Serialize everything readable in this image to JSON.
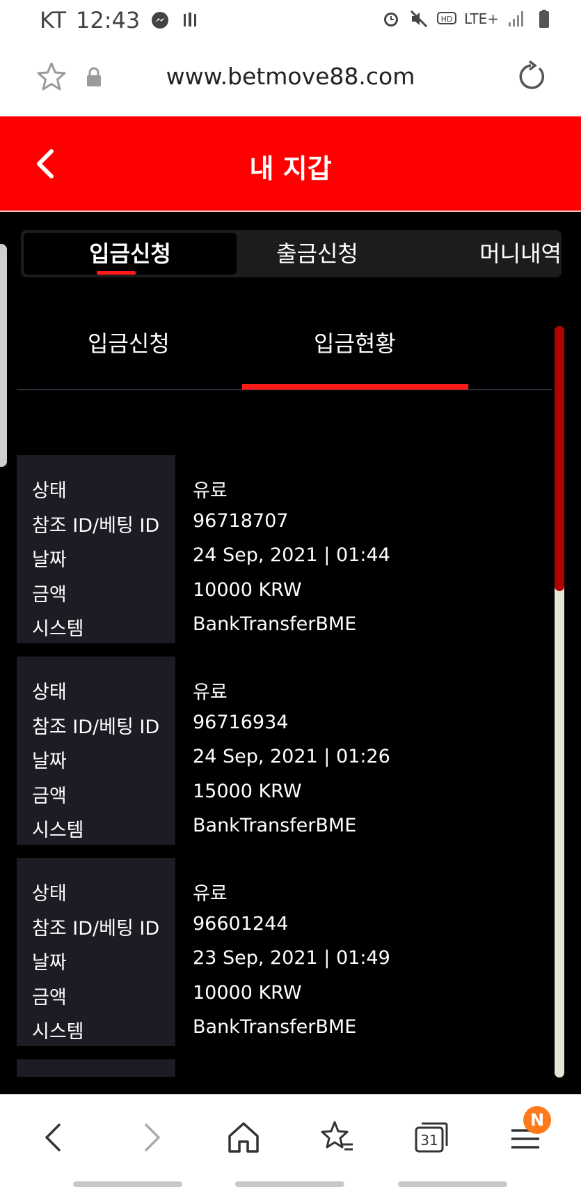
{
  "status_bar": {
    "carrier": "KT",
    "time": "12:43",
    "network": "LTE+"
  },
  "browser": {
    "url": "www.betmove88.com"
  },
  "header": {
    "title": "내 지갑"
  },
  "main_tabs": [
    {
      "label": "입금신청",
      "active": true
    },
    {
      "label": "출금신청",
      "active": false
    },
    {
      "label": "머니내역",
      "active": false
    }
  ],
  "sub_tabs": [
    {
      "label": "입금신청",
      "active": false
    },
    {
      "label": "입금현황",
      "active": true
    }
  ],
  "records": [
    {
      "status_label": "상태",
      "status": "유료",
      "ref_label": "참조 ID/베팅 ID",
      "ref_id": "96718707",
      "date_label": "날짜",
      "date": "24 Sep, 2021 | 01:44",
      "amount_label": "금액",
      "amount": "10000 KRW",
      "system_label": "시스템",
      "system": "BankTransferBME"
    },
    {
      "status_label": "상태",
      "status": "유료",
      "ref_label": "참조 ID/베팅 ID",
      "ref_id": "96716934",
      "date_label": "날짜",
      "date": "24 Sep, 2021 | 01:26",
      "amount_label": "금액",
      "amount": "15000 KRW",
      "system_label": "시스템",
      "system": "BankTransferBME"
    },
    {
      "status_label": "상태",
      "status": "유료",
      "ref_label": "참조 ID/베팅 ID",
      "ref_id": "96601244",
      "date_label": "날짜",
      "date": "23 Sep, 2021 | 01:49",
      "amount_label": "금액",
      "amount": "10000 KRW",
      "system_label": "시스템",
      "system": "BankTransferBME"
    }
  ],
  "bottom_nav": {
    "tabs_count": "31",
    "menu_badge": "N"
  },
  "colors": {
    "accent": "#ff0000",
    "background": "#000000",
    "label_panel": "#1c1d24"
  }
}
